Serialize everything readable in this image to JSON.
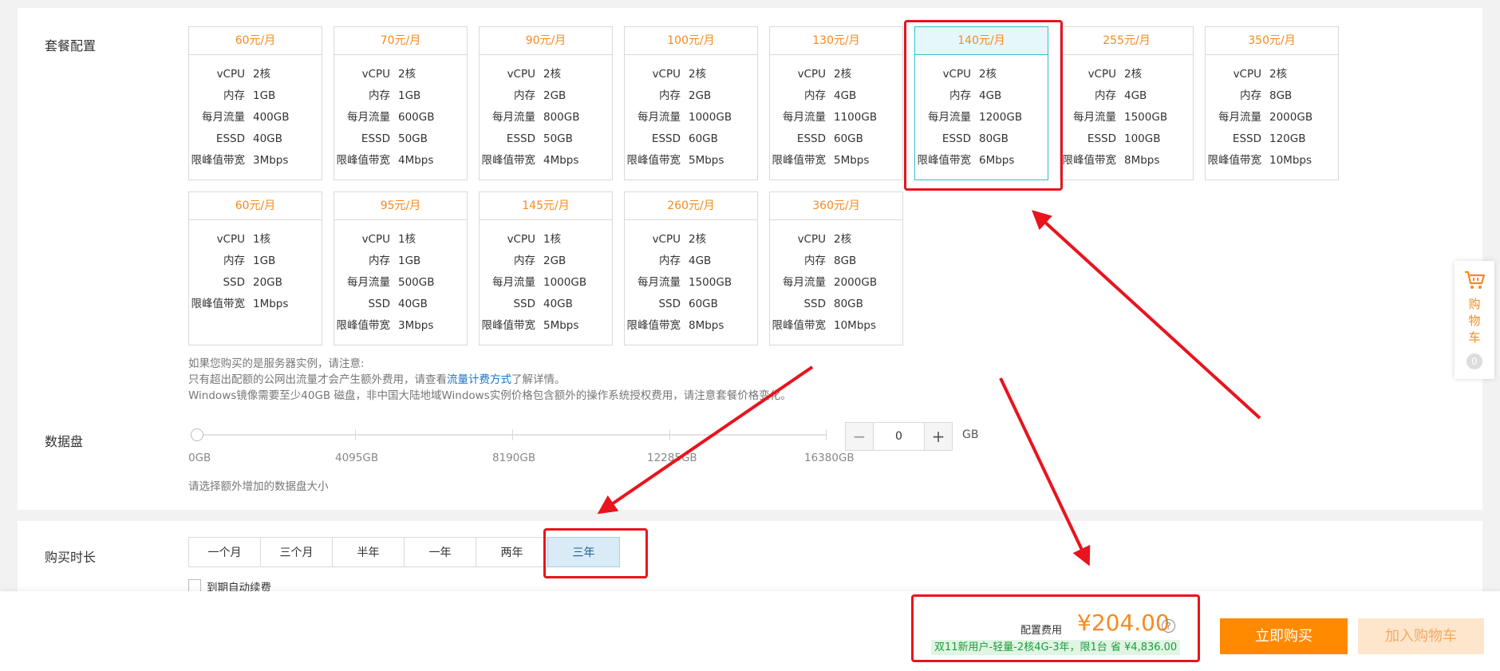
{
  "labels": {
    "package_config": "套餐配置",
    "data_disk": "数据盘",
    "purchase_duration": "购买时长"
  },
  "plans_row1": [
    {
      "price": "60元/月",
      "rows": [
        [
          "vCPU",
          "2核"
        ],
        [
          "内存",
          "1GB"
        ],
        [
          "每月流量",
          "400GB"
        ],
        [
          "ESSD",
          "40GB"
        ],
        [
          "限峰值带宽",
          "3Mbps"
        ]
      ]
    },
    {
      "price": "70元/月",
      "rows": [
        [
          "vCPU",
          "2核"
        ],
        [
          "内存",
          "1GB"
        ],
        [
          "每月流量",
          "600GB"
        ],
        [
          "ESSD",
          "50GB"
        ],
        [
          "限峰值带宽",
          "4Mbps"
        ]
      ]
    },
    {
      "price": "90元/月",
      "rows": [
        [
          "vCPU",
          "2核"
        ],
        [
          "内存",
          "2GB"
        ],
        [
          "每月流量",
          "800GB"
        ],
        [
          "ESSD",
          "50GB"
        ],
        [
          "限峰值带宽",
          "4Mbps"
        ]
      ]
    },
    {
      "price": "100元/月",
      "rows": [
        [
          "vCPU",
          "2核"
        ],
        [
          "内存",
          "2GB"
        ],
        [
          "每月流量",
          "1000GB"
        ],
        [
          "ESSD",
          "60GB"
        ],
        [
          "限峰值带宽",
          "5Mbps"
        ]
      ]
    },
    {
      "price": "130元/月",
      "rows": [
        [
          "vCPU",
          "2核"
        ],
        [
          "内存",
          "4GB"
        ],
        [
          "每月流量",
          "1100GB"
        ],
        [
          "ESSD",
          "60GB"
        ],
        [
          "限峰值带宽",
          "5Mbps"
        ]
      ]
    },
    {
      "price": "140元/月",
      "rows": [
        [
          "vCPU",
          "2核"
        ],
        [
          "内存",
          "4GB"
        ],
        [
          "每月流量",
          "1200GB"
        ],
        [
          "ESSD",
          "80GB"
        ],
        [
          "限峰值带宽",
          "6Mbps"
        ]
      ],
      "selected": true
    },
    {
      "price": "255元/月",
      "rows": [
        [
          "vCPU",
          "2核"
        ],
        [
          "内存",
          "4GB"
        ],
        [
          "每月流量",
          "1500GB"
        ],
        [
          "ESSD",
          "100GB"
        ],
        [
          "限峰值带宽",
          "8Mbps"
        ]
      ]
    },
    {
      "price": "350元/月",
      "rows": [
        [
          "vCPU",
          "2核"
        ],
        [
          "内存",
          "8GB"
        ],
        [
          "每月流量",
          "2000GB"
        ],
        [
          "ESSD",
          "120GB"
        ],
        [
          "限峰值带宽",
          "10Mbps"
        ]
      ]
    }
  ],
  "plans_row2": [
    {
      "price": "60元/月",
      "rows": [
        [
          "vCPU",
          "1核"
        ],
        [
          "内存",
          "1GB"
        ],
        [
          "SSD",
          "20GB"
        ],
        [
          "限峰值带宽",
          "1Mbps"
        ]
      ]
    },
    {
      "price": "95元/月",
      "rows": [
        [
          "vCPU",
          "1核"
        ],
        [
          "内存",
          "1GB"
        ],
        [
          "每月流量",
          "500GB"
        ],
        [
          "SSD",
          "40GB"
        ],
        [
          "限峰值带宽",
          "3Mbps"
        ]
      ]
    },
    {
      "price": "145元/月",
      "rows": [
        [
          "vCPU",
          "1核"
        ],
        [
          "内存",
          "2GB"
        ],
        [
          "每月流量",
          "1000GB"
        ],
        [
          "SSD",
          "40GB"
        ],
        [
          "限峰值带宽",
          "5Mbps"
        ]
      ]
    },
    {
      "price": "260元/月",
      "rows": [
        [
          "vCPU",
          "2核"
        ],
        [
          "内存",
          "4GB"
        ],
        [
          "每月流量",
          "1500GB"
        ],
        [
          "SSD",
          "60GB"
        ],
        [
          "限峰值带宽",
          "8Mbps"
        ]
      ]
    },
    {
      "price": "360元/月",
      "rows": [
        [
          "vCPU",
          "2核"
        ],
        [
          "内存",
          "8GB"
        ],
        [
          "每月流量",
          "2000GB"
        ],
        [
          "SSD",
          "80GB"
        ],
        [
          "限峰值带宽",
          "10Mbps"
        ]
      ]
    }
  ],
  "notes": {
    "line1": "如果您购买的是服务器实例，请注意:",
    "line2_prefix": "只有超出配额的公网出流量才会产生额外费用，请查看",
    "line2_link": "流量计费方式",
    "line2_suffix": "了解详情。",
    "line3": "Windows镜像需要至少40GB 磁盘，非中国大陆地域Windows实例价格包含额外的操作系统授权费用，请注意套餐价格变化。"
  },
  "disk": {
    "ticks": [
      "0GB",
      "4095GB",
      "8190GB",
      "12285GB",
      "16380GB"
    ],
    "value": "0",
    "unit": "GB",
    "minus": "−",
    "plus": "+",
    "hint": "请选择额外增加的数据盘大小"
  },
  "durations": [
    "一个月",
    "三个月",
    "半年",
    "一年",
    "两年",
    "三年"
  ],
  "selected_duration": "三年",
  "auto_renew_label": "到期自动续费",
  "footer": {
    "fee_label": "配置费用",
    "price": "¥204.00",
    "help": "?",
    "promo": "双11新用户-轻量-2核4G-3年，限1台 省 ¥4,836.00",
    "buy_now": "立即购买",
    "add_cart": "加入购物车"
  },
  "cart_float": {
    "label": "购物车",
    "count": "0"
  },
  "colors": {
    "accent_orange": "#ff8a00",
    "price_orange": "#f58a1f",
    "selected_teal": "#39b9d0",
    "annotation_red": "#e8141e",
    "promo_green": "#1a9c3c"
  }
}
